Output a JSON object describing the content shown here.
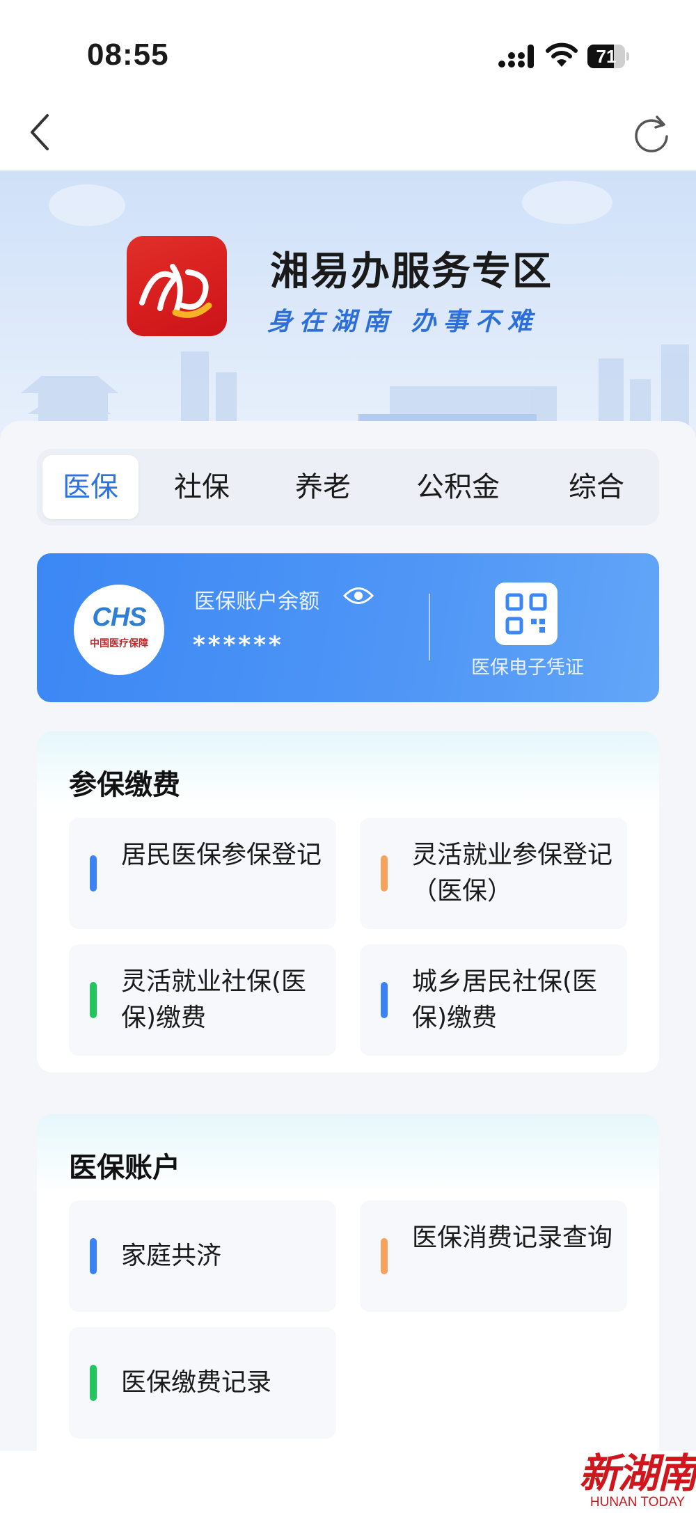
{
  "status_bar": {
    "time": "08:55",
    "battery_level": "71",
    "battery_fraction": 0.71
  },
  "nav": {
    "back_icon": "chevron-left-icon",
    "refresh_icon": "refresh-icon"
  },
  "banner": {
    "title": "湘易办服务专区",
    "slogan": "身在湖南 办事不难",
    "logo_glyph": "湘"
  },
  "tabs": [
    {
      "label": "医保",
      "active": true
    },
    {
      "label": "社保",
      "active": false
    },
    {
      "label": "养老",
      "active": false
    },
    {
      "label": "公积金",
      "active": false
    },
    {
      "label": "综合",
      "active": false
    }
  ],
  "account": {
    "logo_text": "CHS",
    "logo_subtext": "中国医疗保障",
    "balance_label": "医保账户余额",
    "balance_value": "******",
    "qr_label": "医保电子凭证",
    "accent": "#3b87f4"
  },
  "sections": [
    {
      "title": "参保缴费",
      "items": [
        {
          "label": "居民医保参保登记",
          "color": "#3b82f6"
        },
        {
          "label": "灵活就业参保登记（医保）",
          "color": "#f5a25d"
        },
        {
          "label": "灵活就业社保(医保)缴费",
          "color": "#22c55e"
        },
        {
          "label": "城乡居民社保(医保)缴费",
          "color": "#3b82f6"
        }
      ]
    },
    {
      "title": "医保账户",
      "items": [
        {
          "label": "家庭共济",
          "color": "#3b82f6"
        },
        {
          "label": "医保消费记录查询",
          "color": "#f5a25d"
        },
        {
          "label": "医保缴费记录",
          "color": "#22c55e"
        }
      ]
    }
  ],
  "watermark": {
    "text": "新湖南",
    "subtext": "HUNAN TODAY"
  }
}
